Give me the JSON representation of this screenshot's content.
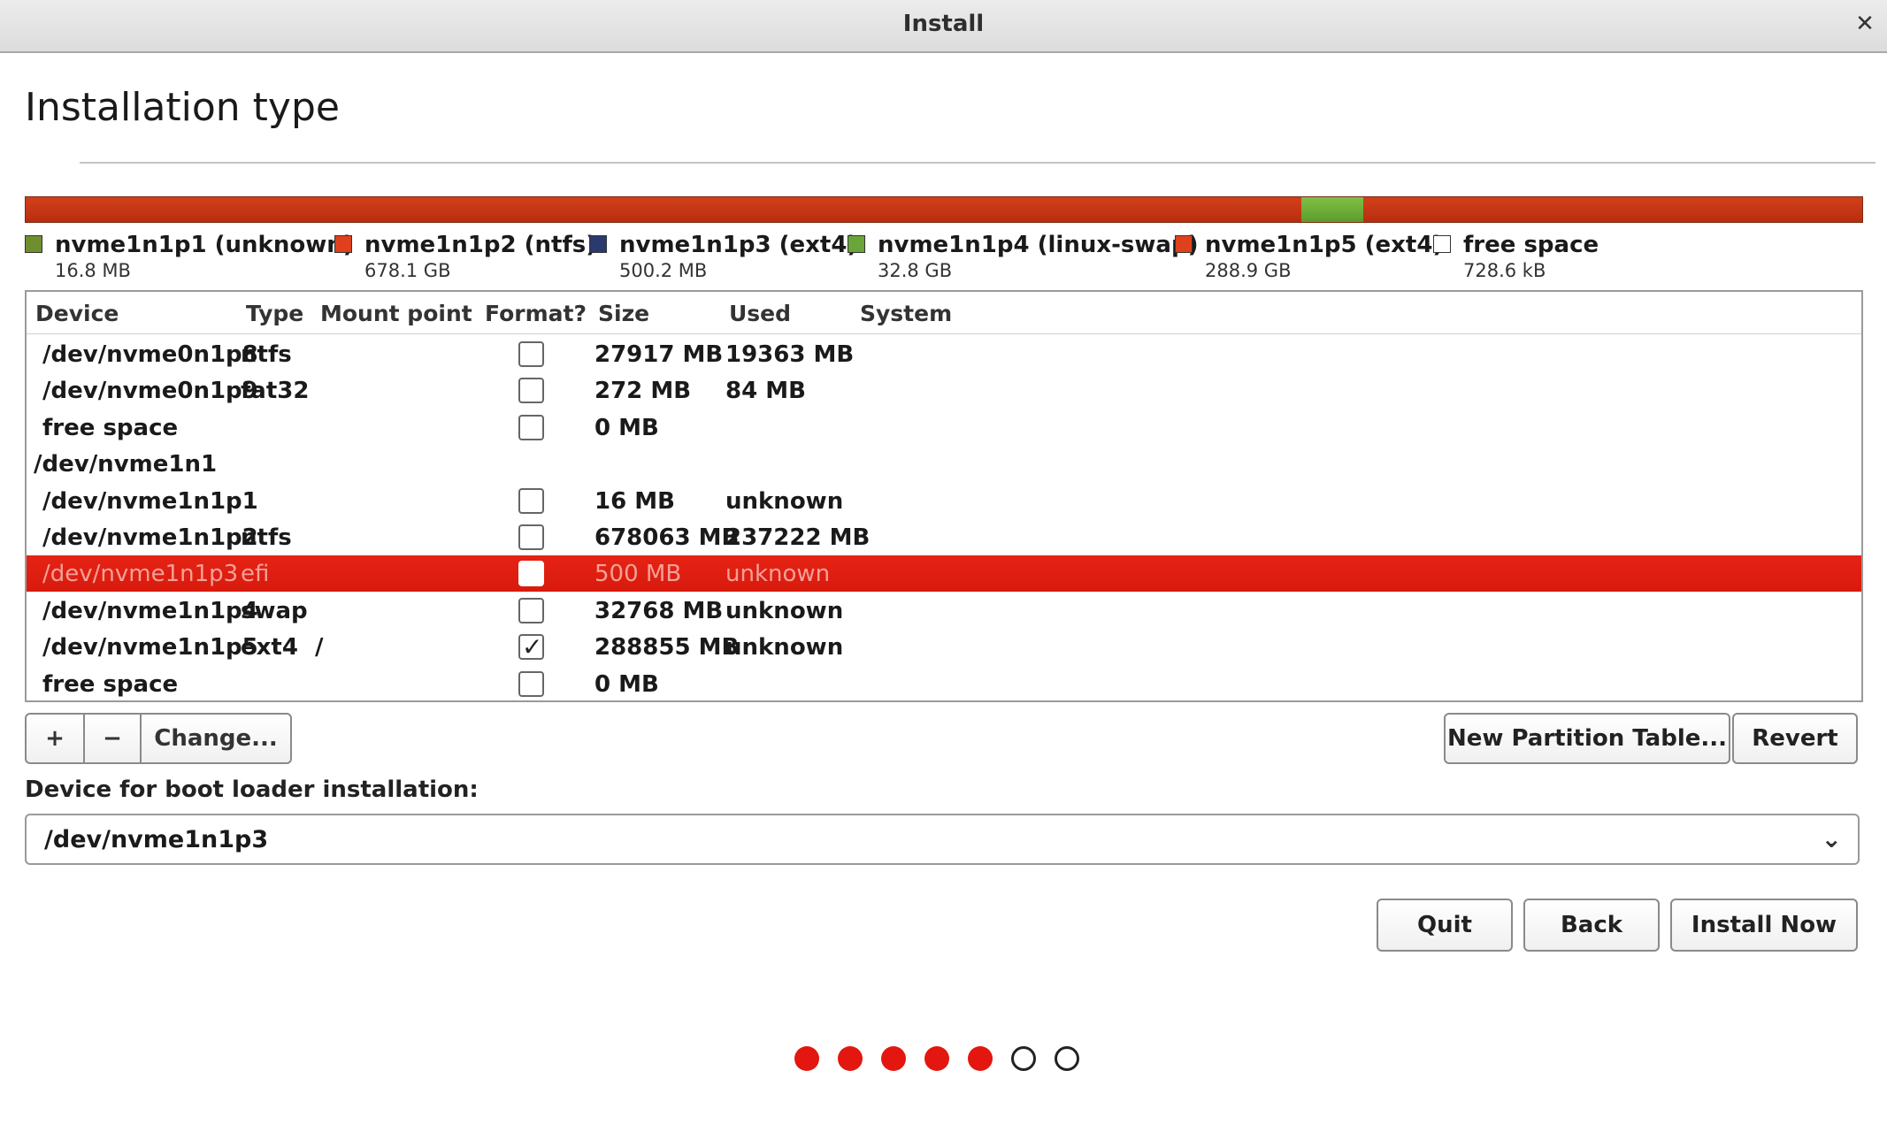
{
  "window": {
    "title": "Install",
    "close_icon": "✕"
  },
  "page_title": "Installation type",
  "colors": {
    "partition_red": "#d2401a",
    "partition_green": "#6dae38",
    "selection": "#e01e12",
    "dot_active": "#e3170f"
  },
  "partition_bar": {
    "segments": [
      {
        "color": "red",
        "fraction": 0.6947
      },
      {
        "color": "green",
        "fraction": 0.0334
      },
      {
        "color": "red",
        "fraction": 0.2719
      }
    ]
  },
  "legend": [
    {
      "name": "nvme1n1p1 (unknown)",
      "size": "16.8 MB",
      "color": "#6f8f2f"
    },
    {
      "name": "nvme1n1p2 (ntfs)",
      "size": "678.1 GB",
      "color": "#e0401e"
    },
    {
      "name": "nvme1n1p3 (ext4)",
      "size": "500.2 MB",
      "color": "#2b3a6e"
    },
    {
      "name": "nvme1n1p4 (linux-swap)",
      "size": "32.8 GB",
      "color": "#6aa53a"
    },
    {
      "name": "nvme1n1p5 (ext4)",
      "size": "288.9 GB",
      "color": "#e0401e"
    },
    {
      "name": "free space",
      "size": "728.6 kB",
      "color": "#ffffff"
    }
  ],
  "table": {
    "headers": {
      "device": "Device",
      "type": "Type",
      "mount": "Mount point",
      "format": "Format?",
      "size": "Size",
      "used": "Used",
      "system": "System"
    },
    "rows": [
      {
        "device": "/dev/nvme0n1p8",
        "type": "ntfs",
        "mount": "",
        "format": false,
        "size": "27917 MB",
        "used": "19363 MB"
      },
      {
        "device": "/dev/nvme0n1p9",
        "type": "fat32",
        "mount": "",
        "format": false,
        "size": "272 MB",
        "used": "84 MB"
      },
      {
        "device": "free space",
        "type": "",
        "mount": "",
        "format": false,
        "size": "0 MB",
        "used": ""
      },
      {
        "device": "/dev/nvme1n1",
        "type": "",
        "mount": "",
        "format": null,
        "size": "",
        "used": ""
      },
      {
        "device": "/dev/nvme1n1p1",
        "type": "",
        "mount": "",
        "format": false,
        "size": "16 MB",
        "used": "unknown"
      },
      {
        "device": "/dev/nvme1n1p2",
        "type": "ntfs",
        "mount": "",
        "format": false,
        "size": "678063 MB",
        "used": "237222 MB"
      },
      {
        "device": "/dev/nvme1n1p3",
        "type": "efi",
        "mount": "",
        "format": false,
        "size": "500 MB",
        "used": "unknown",
        "selected": true
      },
      {
        "device": "/dev/nvme1n1p4",
        "type": "swap",
        "mount": "",
        "format": false,
        "size": "32768 MB",
        "used": "unknown"
      },
      {
        "device": "/dev/nvme1n1p5",
        "type": "ext4",
        "mount": "/",
        "format": true,
        "size": "288855 MB",
        "used": "unknown"
      },
      {
        "device": "free space",
        "type": "",
        "mount": "",
        "format": false,
        "size": "0 MB",
        "used": ""
      }
    ]
  },
  "toolbar": {
    "add_label": "+",
    "remove_label": "−",
    "change_label": "Change...",
    "new_table_label": "New Partition Table...",
    "revert_label": "Revert"
  },
  "boot_loader": {
    "label": "Device for boot loader installation:",
    "value": "/dev/nvme1n1p3",
    "chevron": "⌄"
  },
  "actions": {
    "quit_label": "Quit",
    "back_label": "Back",
    "install_label": "Install Now"
  },
  "progress": {
    "total_steps": 7,
    "completed_steps": 5
  }
}
